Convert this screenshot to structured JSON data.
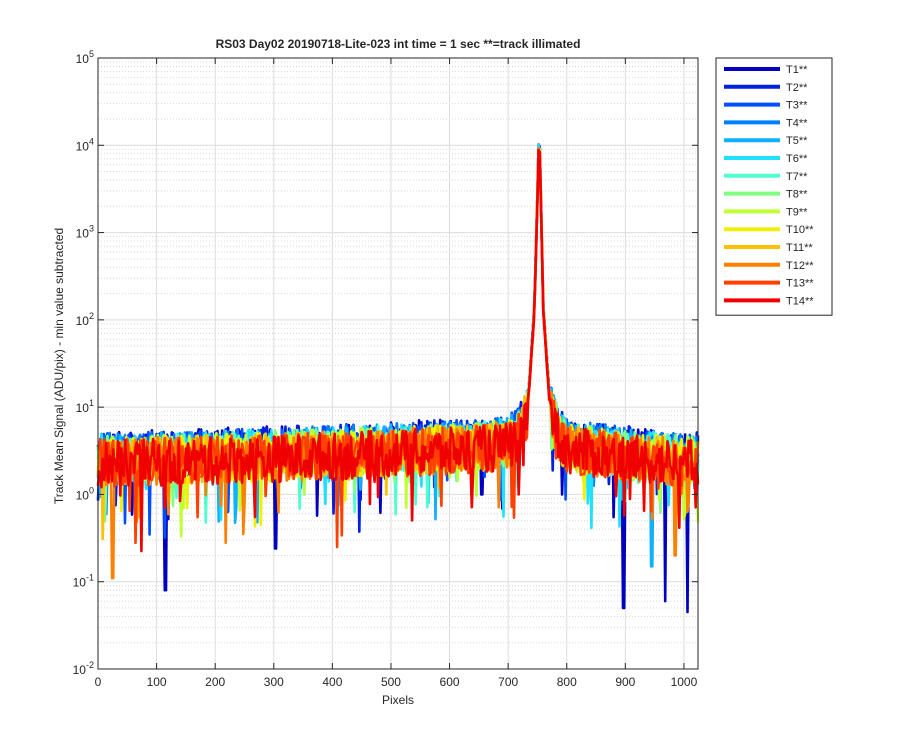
{
  "chart_data": {
    "type": "line",
    "title": "RS03 Day02 20190718-Lite-023 int time = 1 sec    **=track illimated",
    "xlabel": "Pixels",
    "ylabel": "Track Mean Signal (ADU/pix) - min value subtracted",
    "xlim": [
      0,
      1024
    ],
    "ylim": [
      0.01,
      100000
    ],
    "yscale": "log",
    "grid": true,
    "legend_position": "outside-top-right",
    "x_ticks": [
      "0",
      "100",
      "200",
      "300",
      "400",
      "500",
      "600",
      "700",
      "800",
      "900",
      "1000"
    ],
    "y_ticks": [
      {
        "base": "10",
        "exp": "-2",
        "value": 0.01
      },
      {
        "base": "10",
        "exp": "-1",
        "value": 0.1
      },
      {
        "base": "10",
        "exp": "0",
        "value": 1
      },
      {
        "base": "10",
        "exp": "1",
        "value": 10
      },
      {
        "base": "10",
        "exp": "2",
        "value": 100
      },
      {
        "base": "10",
        "exp": "3",
        "value": 1000
      },
      {
        "base": "10",
        "exp": "4",
        "value": 10000
      },
      {
        "base": "10",
        "exp": "5",
        "value": 100000
      }
    ],
    "series": [
      {
        "name": "T1**",
        "color": "#0000bf"
      },
      {
        "name": "T2**",
        "color": "#0020e0"
      },
      {
        "name": "T3**",
        "color": "#0050ff"
      },
      {
        "name": "T4**",
        "color": "#0080ff"
      },
      {
        "name": "T5**",
        "color": "#10b0ff"
      },
      {
        "name": "T6**",
        "color": "#20e0ff"
      },
      {
        "name": "T7**",
        "color": "#50ffd0"
      },
      {
        "name": "T8**",
        "color": "#80ff80"
      },
      {
        "name": "T9**",
        "color": "#c0ff30"
      },
      {
        "name": "T10**",
        "color": "#f0f000"
      },
      {
        "name": "T11**",
        "color": "#ffc000"
      },
      {
        "name": "T12**",
        "color": "#ff8000"
      },
      {
        "name": "T13**",
        "color": "#ff4000"
      },
      {
        "name": "T14**",
        "color": "#f00000"
      }
    ],
    "profile": {
      "peak_x": 753,
      "peak_y": 18000,
      "x": [
        0,
        50,
        100,
        200,
        300,
        400,
        500,
        600,
        650,
        700,
        720,
        735,
        745,
        753,
        760,
        770,
        785,
        800,
        900,
        1000,
        1024
      ],
      "y": [
        3.5,
        3.5,
        3.6,
        3.8,
        4.0,
        4.2,
        4.5,
        4.8,
        5.0,
        5.5,
        7,
        15,
        150,
        18000,
        150,
        15,
        7,
        5,
        4.0,
        3.5,
        3.5
      ]
    },
    "dips": [
      {
        "x": 115,
        "y": 0.08,
        "series": "T1**"
      },
      {
        "x": 303,
        "y": 0.24,
        "series": "T1**"
      },
      {
        "x": 897,
        "y": 0.05,
        "series": "T1**"
      },
      {
        "x": 968,
        "y": 0.06,
        "series": "T1**"
      },
      {
        "x": 1006,
        "y": 0.045,
        "series": "T1**"
      },
      {
        "x": 25,
        "y": 0.11,
        "series": "T12**"
      },
      {
        "x": 218,
        "y": 0.28,
        "series": "T12**"
      },
      {
        "x": 945,
        "y": 0.15,
        "series": "T5**"
      },
      {
        "x": 268,
        "y": 0.55,
        "series": "T14**"
      },
      {
        "x": 655,
        "y": 1.0,
        "series": "T1**"
      },
      {
        "x": 985,
        "y": 0.2,
        "series": "T12**"
      }
    ]
  }
}
